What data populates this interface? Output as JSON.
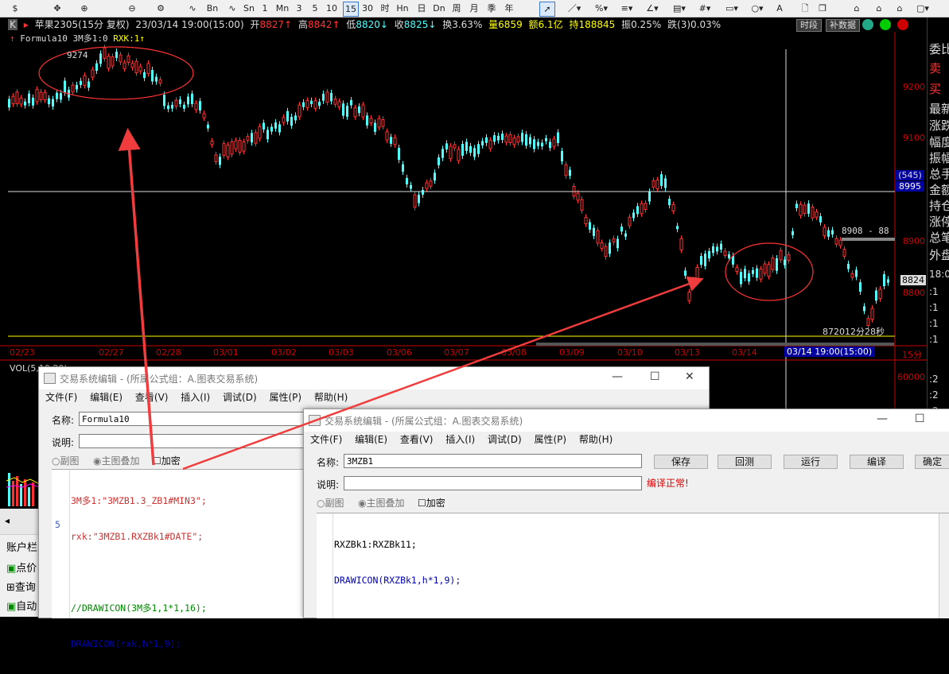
{
  "toolbar": {
    "items": [
      "$",
      "⌘",
      "⚙",
      "∿",
      "Bn",
      "Fn",
      "5n",
      "Mn",
      "1",
      "Mn",
      "3",
      "5",
      "10",
      "15",
      "30",
      "时",
      "Hn",
      "日",
      "On",
      "周",
      "月",
      "季",
      "年",
      "▸",
      "／",
      "%",
      "≡",
      "∠",
      "目",
      "≡",
      "#",
      "○",
      "A",
      "🗋",
      "🗗",
      "⌂",
      "▢"
    ]
  },
  "infobar": {
    "symbol": "苹果2305(15分 复权)",
    "datetime": "23/03/14 19:00(15:00)",
    "open_label": "开",
    "open_value": "8827↑",
    "high_label": "高",
    "high_value": "8842↑",
    "low_label": "低",
    "low_value": "8820↓",
    "close_label": "收",
    "close_value": "8825↓",
    "turnover": "换3.63%",
    "volume": "量6859",
    "amount": "额6.1亿",
    "hold": "持188845",
    "amplitude": "振0.25%",
    "change": "跌(3)0.03%",
    "btn_period": "时段",
    "btn_supplement": "补数据"
  },
  "formula_line": {
    "name": "Formula10",
    "buy": "3M多1:0",
    "rxk": "RXK:1↑"
  },
  "chart": {
    "peak_label": "9274",
    "price_ticks": [
      "9200",
      "9100",
      "9000",
      "8900",
      "8800"
    ],
    "current_price": "8824",
    "cursor_price": "8995",
    "cursor_count": "(545)",
    "hline_label": "8908 - 88",
    "timer": "872012分28秒",
    "dates": [
      "02/23",
      "02/27",
      "02/28",
      "03/01",
      "03/02",
      "03/03",
      "03/06",
      "03/07",
      "03/08",
      "03/09",
      "03/10",
      "03/13",
      "03/14"
    ],
    "cursor_date": "03/14 19:00(15:00)",
    "period": "15分",
    "vol_label": "VOL(5,10,20)",
    "vol_tick": "60000",
    "accent_up": "#ff3232",
    "accent_down": "#54ffff"
  },
  "right_panel": [
    "委比",
    "卖",
    "买",
    "最新",
    "涨跌",
    "幅度",
    "振幅",
    "总手",
    "金额",
    "持仓",
    "涨停",
    "总笔",
    "外盘"
  ],
  "right_panel_values": [
    "18:0",
    ":1",
    ":1",
    ":1",
    ":1",
    ":2",
    ":2",
    ":2",
    ":2"
  ],
  "sidebar": {
    "title": "账户栏",
    "items": [
      "点价",
      "查询",
      "自动"
    ]
  },
  "editor1": {
    "title": "交易系统编辑 - (所属公式组：A.图表交易系统)",
    "menu": [
      "文件(F)",
      "编辑(E)",
      "查看(V)",
      "插入(I)",
      "调试(D)",
      "属性(P)",
      "帮助(H)"
    ],
    "name_label": "名称:",
    "name_value": "Formula10",
    "desc_label": "说明:",
    "radio_sub": "副图",
    "radio_main": "主图叠加",
    "encrypt": "加密",
    "code": [
      "3M多1:\"3MZB1.3_ZB1#MIN3\";",
      "rxk:\"3MZB1.RXZBk1#DATE\";",
      "",
      "//DRAWICON(3M多1,1*1,16);",
      "DRAWICON(rxk,h*1,9);"
    ],
    "line_number": "5"
  },
  "editor2": {
    "title": "交易系统编辑 - (所属公式组：A.图表交易系统)",
    "menu": [
      "文件(F)",
      "编辑(E)",
      "查看(V)",
      "插入(I)",
      "调试(D)",
      "属性(P)",
      "帮助(H)"
    ],
    "name_label": "名称:",
    "name_value": "3MZB1",
    "desc_label": "说明:",
    "compile_status": "编译正常!",
    "buttons": [
      "保存",
      "回测",
      "运行",
      "编译",
      "确定"
    ],
    "radio_sub": "副图",
    "radio_main": "主图叠加",
    "encrypt": "加密",
    "code": [
      "RXZBk1:RXZBk11;",
      "DRAWICON(RXZBk1,h*1,9);"
    ]
  }
}
